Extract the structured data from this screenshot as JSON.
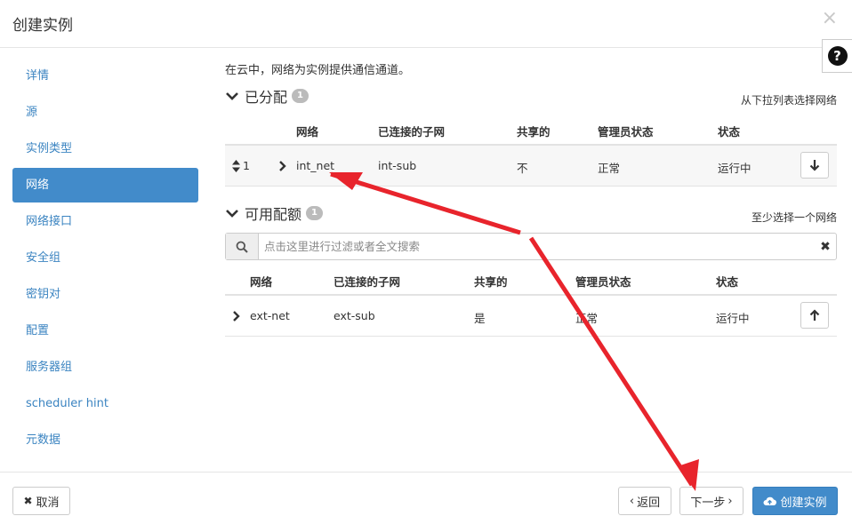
{
  "header": {
    "title": "创建实例",
    "close_label": "×",
    "help_label": "?"
  },
  "sidebar": {
    "items": [
      {
        "label": "详情",
        "active": false
      },
      {
        "label": "源",
        "active": false
      },
      {
        "label": "实例类型",
        "active": false
      },
      {
        "label": "网络",
        "active": true
      },
      {
        "label": "网络接口",
        "active": false
      },
      {
        "label": "安全组",
        "active": false
      },
      {
        "label": "密钥对",
        "active": false
      },
      {
        "label": "配置",
        "active": false
      },
      {
        "label": "服务器组",
        "active": false
      },
      {
        "label": "scheduler hint",
        "active": false
      },
      {
        "label": "元数据",
        "active": false
      }
    ]
  },
  "main": {
    "intro": "在云中，网络为实例提供通信通道。",
    "allocated": {
      "title": "已分配",
      "count": "1",
      "hint": "从下拉列表选择网络",
      "columns": [
        "网络",
        "已连接的子网",
        "共享的",
        "管理员状态",
        "状态"
      ],
      "rows": [
        {
          "index": "1",
          "network": "int_net",
          "subnet": "int-sub",
          "shared": "不",
          "admin_state": "正常",
          "status": "运行中"
        }
      ]
    },
    "available": {
      "title": "可用配额",
      "count": "1",
      "hint": "至少选择一个网络",
      "filter_placeholder": "点击这里进行过滤或者全文搜索",
      "columns": [
        "网络",
        "已连接的子网",
        "共享的",
        "管理员状态",
        "状态"
      ],
      "rows": [
        {
          "network": "ext-net",
          "subnet": "ext-sub",
          "shared": "是",
          "admin_state": "正常",
          "status": "运行中"
        }
      ]
    }
  },
  "footer": {
    "cancel_label": "取消",
    "back_label": "返回",
    "next_label": "下一步",
    "create_label": "创建实例"
  },
  "colors": {
    "primary": "#428bca",
    "link": "#3b84c1",
    "annotation_arrow": "#e8242c"
  }
}
